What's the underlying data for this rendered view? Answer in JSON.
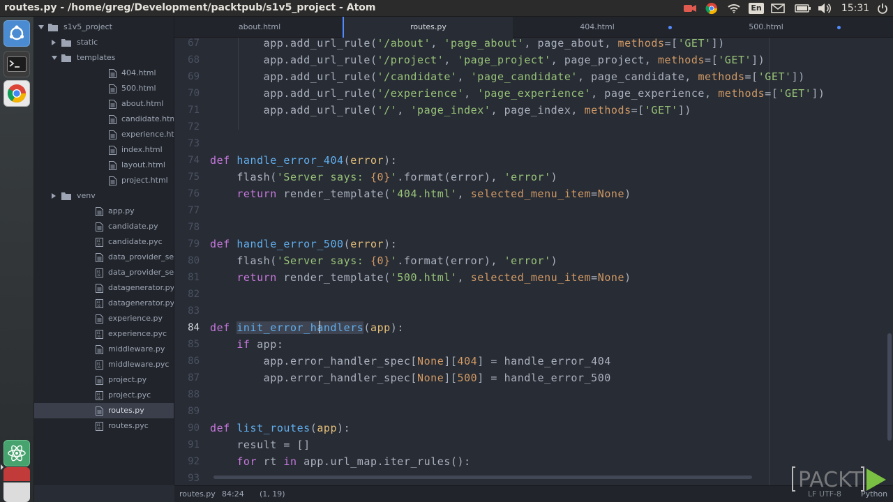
{
  "top_panel": {
    "window_title": "routes.py - /home/greg/Development/packtpub/s1v5_project - Atom",
    "keyboard_layout": "En",
    "clock": "15:31"
  },
  "launcher": {
    "items": [
      "dash-icon",
      "terminal-icon",
      "chrome-icon",
      "atom-icon",
      "app-icon",
      "trash-icon"
    ]
  },
  "tree": {
    "items": [
      {
        "label": "s1v5_project",
        "type": "folder",
        "expanded": true,
        "depth": 0
      },
      {
        "label": "static",
        "type": "folder",
        "expanded": false,
        "depth": 1
      },
      {
        "label": "templates",
        "type": "folder",
        "expanded": true,
        "depth": 1
      },
      {
        "label": "404.html",
        "type": "file",
        "depth": 2
      },
      {
        "label": "500.html",
        "type": "file",
        "depth": 2
      },
      {
        "label": "about.html",
        "type": "file",
        "depth": 2
      },
      {
        "label": "candidate.html",
        "type": "file",
        "depth": 2
      },
      {
        "label": "experience.html",
        "type": "file",
        "depth": 2
      },
      {
        "label": "index.html",
        "type": "file",
        "depth": 2
      },
      {
        "label": "layout.html",
        "type": "file",
        "depth": 2
      },
      {
        "label": "project.html",
        "type": "file",
        "depth": 2
      },
      {
        "label": "venv",
        "type": "folder",
        "expanded": false,
        "depth": 1
      },
      {
        "label": "app.py",
        "type": "file",
        "depth": 1
      },
      {
        "label": "candidate.py",
        "type": "file",
        "depth": 1
      },
      {
        "label": "candidate.pyc",
        "type": "binary",
        "depth": 1
      },
      {
        "label": "data_provider_service.py",
        "type": "file",
        "depth": 1
      },
      {
        "label": "data_provider_service.pyc",
        "type": "binary",
        "depth": 1
      },
      {
        "label": "datagenerator.py",
        "type": "file",
        "depth": 1
      },
      {
        "label": "datagenerator.pyc",
        "type": "binary",
        "depth": 1
      },
      {
        "label": "experience.py",
        "type": "file",
        "depth": 1
      },
      {
        "label": "experience.pyc",
        "type": "binary",
        "depth": 1
      },
      {
        "label": "middleware.py",
        "type": "file",
        "depth": 1
      },
      {
        "label": "middleware.pyc",
        "type": "binary",
        "depth": 1
      },
      {
        "label": "project.py",
        "type": "file",
        "depth": 1
      },
      {
        "label": "project.pyc",
        "type": "binary",
        "depth": 1
      },
      {
        "label": "routes.py",
        "type": "file",
        "depth": 1,
        "selected": true
      },
      {
        "label": "routes.pyc",
        "type": "binary",
        "depth": 1
      }
    ]
  },
  "tabs": [
    {
      "label": "about.html",
      "active": false,
      "modified": false
    },
    {
      "label": "routes.py",
      "active": true,
      "modified": false
    },
    {
      "label": "404.html",
      "active": false,
      "modified": true
    },
    {
      "label": "500.html",
      "active": false,
      "modified": true
    }
  ],
  "editor": {
    "current_line": 84,
    "lines": [
      {
        "n": "67",
        "tokens": [
          [
            "",
            "        app.add_url_rule("
          ],
          [
            "str",
            "'/about'"
          ],
          [
            "",
            ", "
          ],
          [
            "str",
            "'page_about'"
          ],
          [
            "",
            ", page_about, "
          ],
          [
            "ar",
            "methods"
          ],
          [
            "",
            "=["
          ],
          [
            "str",
            "'GET'"
          ],
          [
            "",
            "])"
          ]
        ]
      },
      {
        "n": "68",
        "tokens": [
          [
            "",
            "        app.add_url_rule("
          ],
          [
            "str",
            "'/project'"
          ],
          [
            "",
            ", "
          ],
          [
            "str",
            "'page_project'"
          ],
          [
            "",
            ", page_project, "
          ],
          [
            "ar",
            "methods"
          ],
          [
            "",
            "=["
          ],
          [
            "str",
            "'GET'"
          ],
          [
            "",
            "])"
          ]
        ]
      },
      {
        "n": "69",
        "tokens": [
          [
            "",
            "        app.add_url_rule("
          ],
          [
            "str",
            "'/candidate'"
          ],
          [
            "",
            ", "
          ],
          [
            "str",
            "'page_candidate'"
          ],
          [
            "",
            ", page_candidate, "
          ],
          [
            "ar",
            "methods"
          ],
          [
            "",
            "=["
          ],
          [
            "str",
            "'GET'"
          ],
          [
            "",
            "])"
          ]
        ]
      },
      {
        "n": "70",
        "tokens": [
          [
            "",
            "        app.add_url_rule("
          ],
          [
            "str",
            "'/experience'"
          ],
          [
            "",
            ", "
          ],
          [
            "str",
            "'page_experience'"
          ],
          [
            "",
            ", page_experience, "
          ],
          [
            "ar",
            "methods"
          ],
          [
            "",
            "=["
          ],
          [
            "str",
            "'GET'"
          ],
          [
            "",
            "])"
          ]
        ]
      },
      {
        "n": "71",
        "tokens": [
          [
            "",
            "        app.add_url_rule("
          ],
          [
            "str",
            "'/'"
          ],
          [
            "",
            ", "
          ],
          [
            "str",
            "'page_index'"
          ],
          [
            "",
            ", page_index, "
          ],
          [
            "ar",
            "methods"
          ],
          [
            "",
            "=["
          ],
          [
            "str",
            "'GET'"
          ],
          [
            "",
            "])"
          ]
        ]
      },
      {
        "n": "72",
        "tokens": []
      },
      {
        "n": "73",
        "tokens": []
      },
      {
        "n": "74",
        "tokens": [
          [
            "kw",
            "def"
          ],
          [
            "",
            " "
          ],
          [
            "fn",
            "handle_error_404"
          ],
          [
            "",
            "("
          ],
          [
            "pr",
            "error"
          ],
          [
            "",
            "):"
          ]
        ]
      },
      {
        "n": "75",
        "tokens": [
          [
            "",
            "    flash("
          ],
          [
            "str",
            "'Server says: "
          ],
          [
            "nn",
            "{0}"
          ],
          [
            "str",
            "'"
          ],
          [
            "",
            ".format(error), "
          ],
          [
            "str",
            "'error'"
          ],
          [
            "",
            ")"
          ]
        ]
      },
      {
        "n": "76",
        "tokens": [
          [
            "",
            "    "
          ],
          [
            "kw",
            "return"
          ],
          [
            "",
            " render_template("
          ],
          [
            "str",
            "'404.html'"
          ],
          [
            "",
            ", "
          ],
          [
            "ar",
            "selected_menu_item"
          ],
          [
            "",
            "="
          ],
          [
            "nn",
            "None"
          ],
          [
            "",
            ")"
          ]
        ]
      },
      {
        "n": "77",
        "tokens": []
      },
      {
        "n": "78",
        "tokens": []
      },
      {
        "n": "79",
        "tokens": [
          [
            "kw",
            "def"
          ],
          [
            "",
            " "
          ],
          [
            "fn",
            "handle_error_500"
          ],
          [
            "",
            "("
          ],
          [
            "pr",
            "error"
          ],
          [
            "",
            "):"
          ]
        ]
      },
      {
        "n": "80",
        "tokens": [
          [
            "",
            "    flash("
          ],
          [
            "str",
            "'Server says: "
          ],
          [
            "nn",
            "{0}"
          ],
          [
            "str",
            "'"
          ],
          [
            "",
            ".format(error), "
          ],
          [
            "str",
            "'error'"
          ],
          [
            "",
            ")"
          ]
        ]
      },
      {
        "n": "81",
        "tokens": [
          [
            "",
            "    "
          ],
          [
            "kw",
            "return"
          ],
          [
            "",
            " render_template("
          ],
          [
            "str",
            "'500.html'"
          ],
          [
            "",
            ", "
          ],
          [
            "ar",
            "selected_menu_item"
          ],
          [
            "",
            "="
          ],
          [
            "nn",
            "None"
          ],
          [
            "",
            ")"
          ]
        ]
      },
      {
        "n": "82",
        "tokens": []
      },
      {
        "n": "83",
        "tokens": []
      },
      {
        "n": "84",
        "tokens": [
          [
            "kw",
            "def"
          ],
          [
            "",
            " "
          ],
          [
            "sel",
            "init_error_handlers"
          ],
          [
            "",
            "("
          ],
          [
            "pr",
            "app"
          ],
          [
            "",
            "):"
          ]
        ]
      },
      {
        "n": "85",
        "tokens": [
          [
            "",
            "    "
          ],
          [
            "kw",
            "if"
          ],
          [
            "",
            " app:"
          ]
        ]
      },
      {
        "n": "86",
        "tokens": [
          [
            "",
            "        app.error_handler_spec["
          ],
          [
            "nn",
            "None"
          ],
          [
            "",
            "]["
          ],
          [
            "nn",
            "404"
          ],
          [
            "",
            "] = handle_error_404"
          ]
        ]
      },
      {
        "n": "87",
        "tokens": [
          [
            "",
            "        app.error_handler_spec["
          ],
          [
            "nn",
            "None"
          ],
          [
            "",
            "]["
          ],
          [
            "nn",
            "500"
          ],
          [
            "",
            "] = handle_error_500"
          ]
        ]
      },
      {
        "n": "88",
        "tokens": []
      },
      {
        "n": "89",
        "tokens": []
      },
      {
        "n": "90",
        "tokens": [
          [
            "kw",
            "def"
          ],
          [
            "",
            " "
          ],
          [
            "fn",
            "list_routes"
          ],
          [
            "",
            "("
          ],
          [
            "pr",
            "app"
          ],
          [
            "",
            "):"
          ]
        ]
      },
      {
        "n": "91",
        "tokens": [
          [
            "",
            "    result = []"
          ]
        ]
      },
      {
        "n": "92",
        "tokens": [
          [
            "",
            "    "
          ],
          [
            "kw",
            "for"
          ],
          [
            "",
            " rt "
          ],
          [
            "kw",
            "in"
          ],
          [
            "",
            " app.url_map.iter_rules():"
          ]
        ]
      },
      {
        "n": "93",
        "tokens": []
      }
    ]
  },
  "status_bar": {
    "file": "routes.py",
    "cursor": "84:24",
    "selection": "(1, 19)",
    "encoding": "LF  UTF-8",
    "grammar": "Python"
  },
  "watermark": {
    "text": "PACKT"
  },
  "colors": {
    "editor_bg": "#282c34",
    "panel_bg": "#21252b",
    "keyword": "#c678dd",
    "function": "#61afef",
    "string": "#98c379",
    "number": "#d19a66",
    "accent": "#528bff"
  }
}
